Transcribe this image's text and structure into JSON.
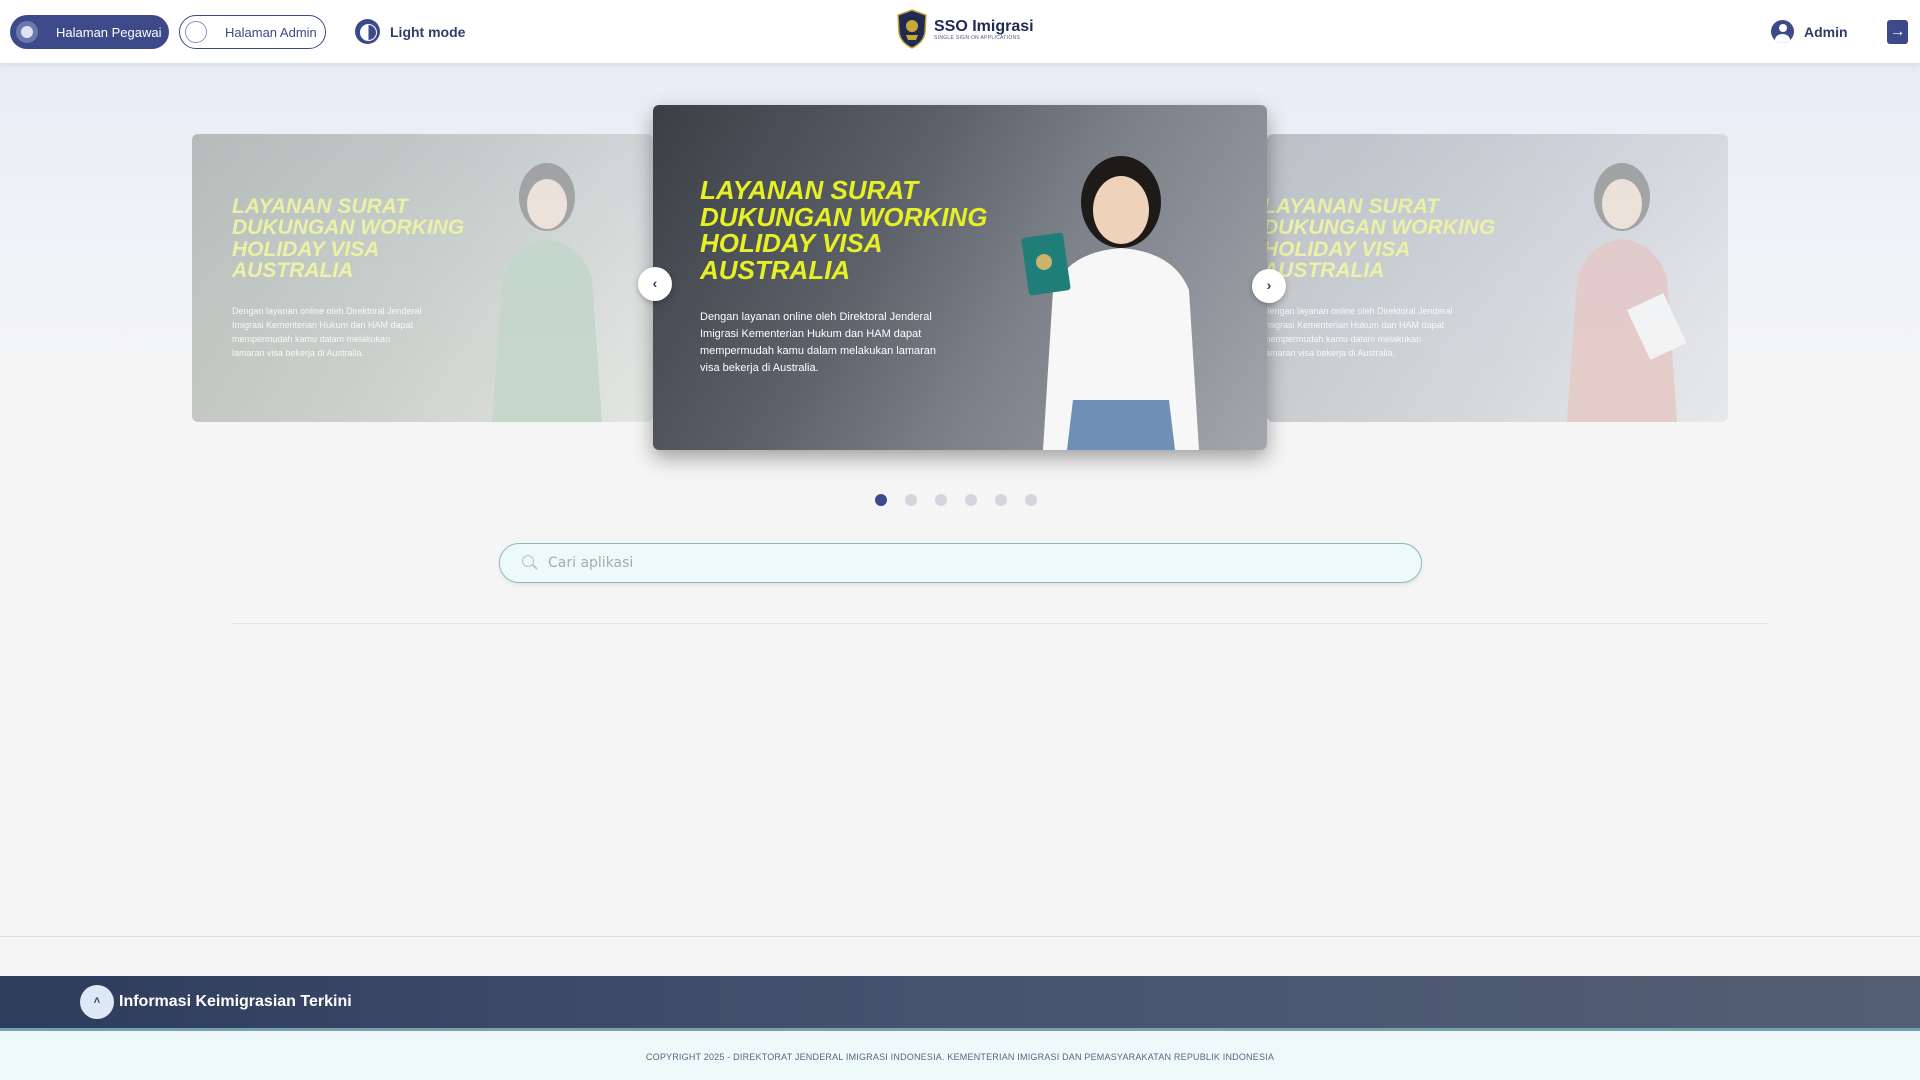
{
  "header": {
    "pegawai_label": "Halaman Pegawai",
    "admin_label": "Halaman Admin",
    "theme_label": "Light mode",
    "logo_title": "SSO Imigrasi",
    "logo_subtitle": "SINGLE SIGN ON APPLICATIONS",
    "user_name": "Admin"
  },
  "carousel": {
    "slides": [
      {
        "title": "LAYANAN SURAT DUKUNGAN WORKING HOLIDAY VISA AUSTRALIA",
        "description": "Dengan layanan online oleh Direktoral Jenderal Imigrasi Kementerian Hukum dan HAM dapat mempermudah kamu dalam melakukan lamaran visa bekerja di Australia."
      },
      {
        "title": "LAYANAN SURAT DUKUNGAN WORKING HOLIDAY VISA AUSTRALIA",
        "description": "Dengan layanan online oleh Direktoral Jenderal Imigrasi Kementerian Hukum dan HAM dapat mempermudah kamu dalam melakukan lamaran visa bekerja di Australia."
      },
      {
        "title": "LAYANAN SURAT DUKUNGAN WORKING HOLIDAY VISA AUSTRALIA",
        "description": "Dengan layanan online oleh Direktoral Jenderal Imigrasi Kementerian Hukum dan HAM dapat mempermudah kamu dalam melakukan lamaran visa bekerja di Australia."
      }
    ],
    "prev_symbol": "‹",
    "next_symbol": "›",
    "dot_count": 6,
    "active_dot": 1
  },
  "search": {
    "placeholder": "Cari aplikasi"
  },
  "footer": {
    "toggle_symbol": "˄",
    "title": "Informasi Keimigrasian Terkini",
    "copyright": "COPYRIGHT 2025 - DIREKTORAT JENDERAL IMIGRASI INDONESIA. KEMENTERIAN IMIGRASI DAN PEMASYARAKATAN REPUBLIK INDONESIA"
  },
  "colors": {
    "primary": "#3d4a8a",
    "slide_title": "#e6f025",
    "footer_bar": "#2e3c5c"
  }
}
